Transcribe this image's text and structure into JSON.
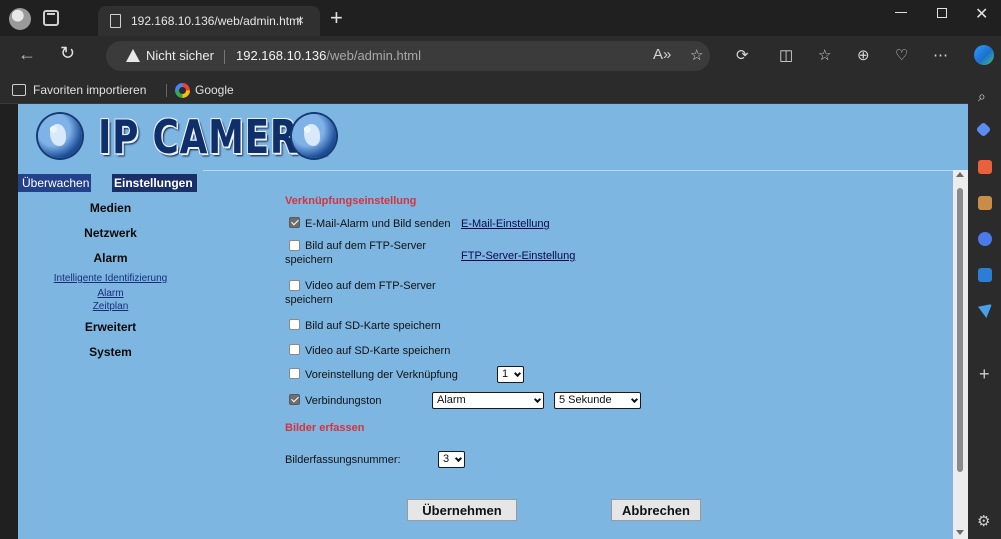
{
  "browser": {
    "tab_title": "192.168.10.136/web/admin.html",
    "tab_close": "×",
    "new_tab": "+",
    "security": "Nicht sicher",
    "url_host": "192.168.10.136",
    "url_path": "/web/admin.html",
    "window_close": "✕"
  },
  "favorites": {
    "import": "Favoriten importieren",
    "google": "Google"
  },
  "header": {
    "logo_text": "IP CAMERA"
  },
  "nav": {
    "tab_overview": "Überwachen",
    "tab_settings": "Einstellungen",
    "media": "Medien",
    "network": "Netzwerk",
    "alarm": "Alarm",
    "sub_smart": "Intelligente Identifizierung",
    "sub_alarm": "Alarm",
    "sub_schedule": "Zeitplan",
    "advanced": "Erweitert",
    "system": "System"
  },
  "form": {
    "section_link": "Verknüpfungseinstellung",
    "email_label": "E-Mail-Alarm und Bild senden",
    "email_link": "E-Mail-Einstellung",
    "ftp_pic_label_1": "Bild auf dem FTP-Server",
    "ftp_pic_label_2": "speichern",
    "ftp_link": "FTP-Server-Einstellung",
    "ftp_vid_label_1": "Video auf dem FTP-Server",
    "ftp_vid_label_2": "speichern",
    "sd_pic_label": "Bild auf SD-Karte speichern",
    "sd_vid_label": "Video auf SD-Karte speichern",
    "preset_label": "Voreinstellung der Verknüpfung",
    "preset_value": "1",
    "tone_label": "Verbindungston",
    "tone_value": "Alarm",
    "duration_value": "5 Sekunde",
    "section_capture": "Bilder erfassen",
    "capture_label": "Bilderfassungsnummer:",
    "capture_value": "3",
    "apply": "Übernehmen",
    "cancel": "Abbrechen"
  },
  "state": {
    "email_checked": true,
    "ftp_pic_checked": false,
    "ftp_vid_checked": false,
    "sd_pic_checked": false,
    "sd_vid_checked": false,
    "preset_checked": false,
    "tone_checked": true
  },
  "colors": {
    "page_bg": "#7eb6e2",
    "section_title": "#d6333d",
    "nav_tab_active": "#1a2f68"
  },
  "icons": {
    "profile": "profile-avatar-icon",
    "back": "back-arrow-icon",
    "reload": "reload-icon",
    "warning": "warning-triangle-icon",
    "favorite": "star-icon",
    "edge": "edge-copilot-icon"
  }
}
